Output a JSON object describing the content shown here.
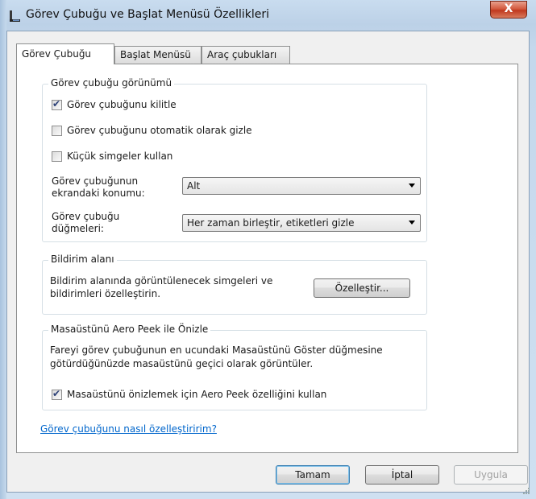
{
  "window": {
    "title": "Görev Çubuğu ve Başlat Menüsü Özellikleri",
    "close_glyph": "X"
  },
  "tabs": [
    {
      "label": "Görev Çubuğu",
      "selected": true
    },
    {
      "label": "Başlat Menüsü",
      "selected": false
    },
    {
      "label": "Araç çubukları",
      "selected": false
    }
  ],
  "appearance": {
    "legend": "Görev çubuğu görünümü",
    "lock_taskbar": {
      "label": "Görev çubuğunu kilitle",
      "checked": true
    },
    "auto_hide": {
      "label": "Görev çubuğunu otomatik olarak gizle",
      "checked": false
    },
    "small_icons": {
      "label": "Küçük simgeler kullan",
      "checked": false
    },
    "location_label_1": "Görev çubuğunun",
    "location_label_2": "ekrandaki konumu:",
    "location_value": "Alt",
    "buttons_label_1": "Görev çubuğu",
    "buttons_label_2": "düğmeleri:",
    "buttons_value": "Her zaman birleştir, etiketleri gizle"
  },
  "notification": {
    "legend": "Bildirim alanı",
    "text_1": "Bildirim alanında görüntülenecek simgeleri ve",
    "text_2": "bildirimleri özelleştirin.",
    "customize_label": "Özelleştir..."
  },
  "aero_peek": {
    "legend": "Masaüstünü Aero Peek ile Önizle",
    "text_1": "Fareyi görev çubuğunun en ucundaki Masaüstünü Göster düğmesine",
    "text_2": "götürdüğünüzde masaüstünü geçici olarak görüntüler.",
    "use_peek": {
      "label": "Masaüstünü önizlemek için Aero Peek özelliğini kullan",
      "checked": true
    }
  },
  "help_link": "Görev çubuğunu nasıl özelleştiririm?",
  "footer": {
    "ok_label": "Tamam",
    "cancel_label": "İptal",
    "apply_label": "Uygula"
  }
}
